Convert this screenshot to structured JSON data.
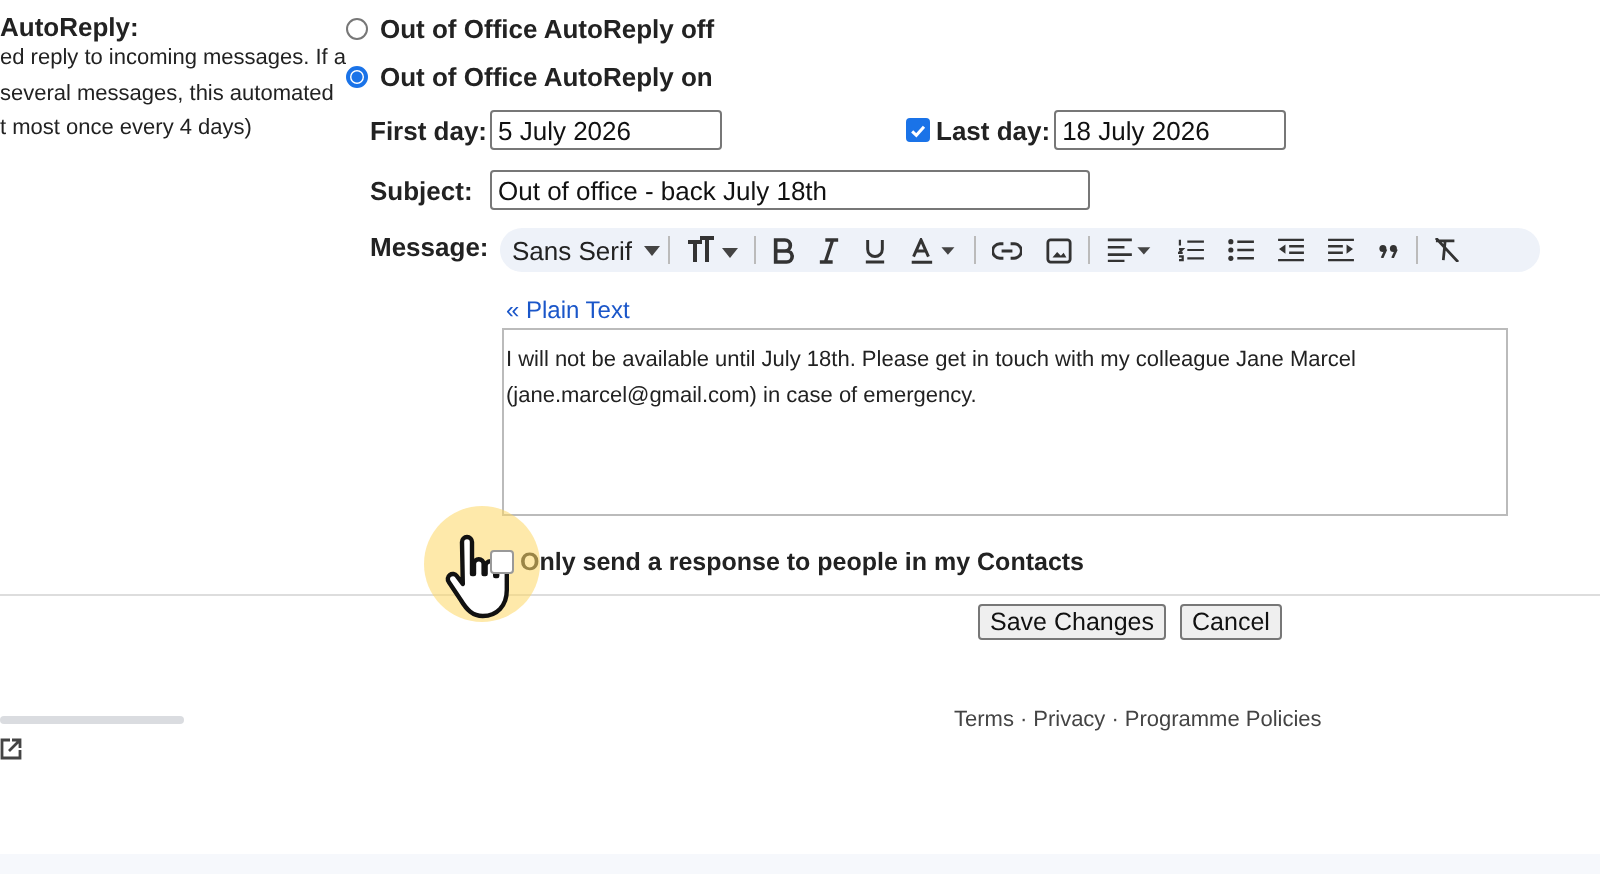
{
  "left_panel": {
    "heading": "AutoReply:",
    "description_lines": [
      "ed reply to incoming messages. If a",
      "several messages, this automated",
      "t most once every 4 days)"
    ]
  },
  "autoreply_options": [
    {
      "label": "Out of Office AutoReply off",
      "selected": false
    },
    {
      "label": "Out of Office AutoReply on",
      "selected": true
    }
  ],
  "first_day": {
    "label": "First day:",
    "value": "5 July 2026"
  },
  "last_day": {
    "label": "Last day:",
    "value": "18 July 2026",
    "checked": true
  },
  "subject": {
    "label": "Subject:",
    "value": "Out of office - back July 18th"
  },
  "message": {
    "label": "Message:",
    "font": "Sans Serif",
    "plain_text_link": "« Plain Text",
    "body": "I will not be available until July 18th. Please get in touch with my colleague Jane Marcel (jane.marcel@gmail.com) in case of emergency."
  },
  "contacts_only": {
    "label": "Only send a response to people in my Contacts",
    "checked": false
  },
  "buttons": [
    "Save Changes",
    "Cancel"
  ],
  "footer_links": [
    "Terms",
    "Privacy",
    "Programme Policies"
  ],
  "footer_separator": "·"
}
